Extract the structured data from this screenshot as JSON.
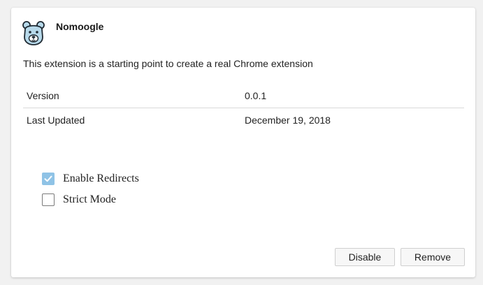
{
  "extension": {
    "name": "Nomoogle",
    "description": "This extension is a starting point to create a real Chrome extension",
    "logo_icon": "polar-bear-icon"
  },
  "info": [
    {
      "label": "Version",
      "value": "0.0.1"
    },
    {
      "label": "Last Updated",
      "value": "December 19, 2018"
    }
  ],
  "options": [
    {
      "label": "Enable Redirects",
      "checked": true
    },
    {
      "label": "Strict Mode",
      "checked": false
    }
  ],
  "actions": {
    "disable_label": "Disable",
    "remove_label": "Remove"
  },
  "colors": {
    "checkbox_checked": "#8fc3e6",
    "logo_fill": "#b7d9ea"
  }
}
